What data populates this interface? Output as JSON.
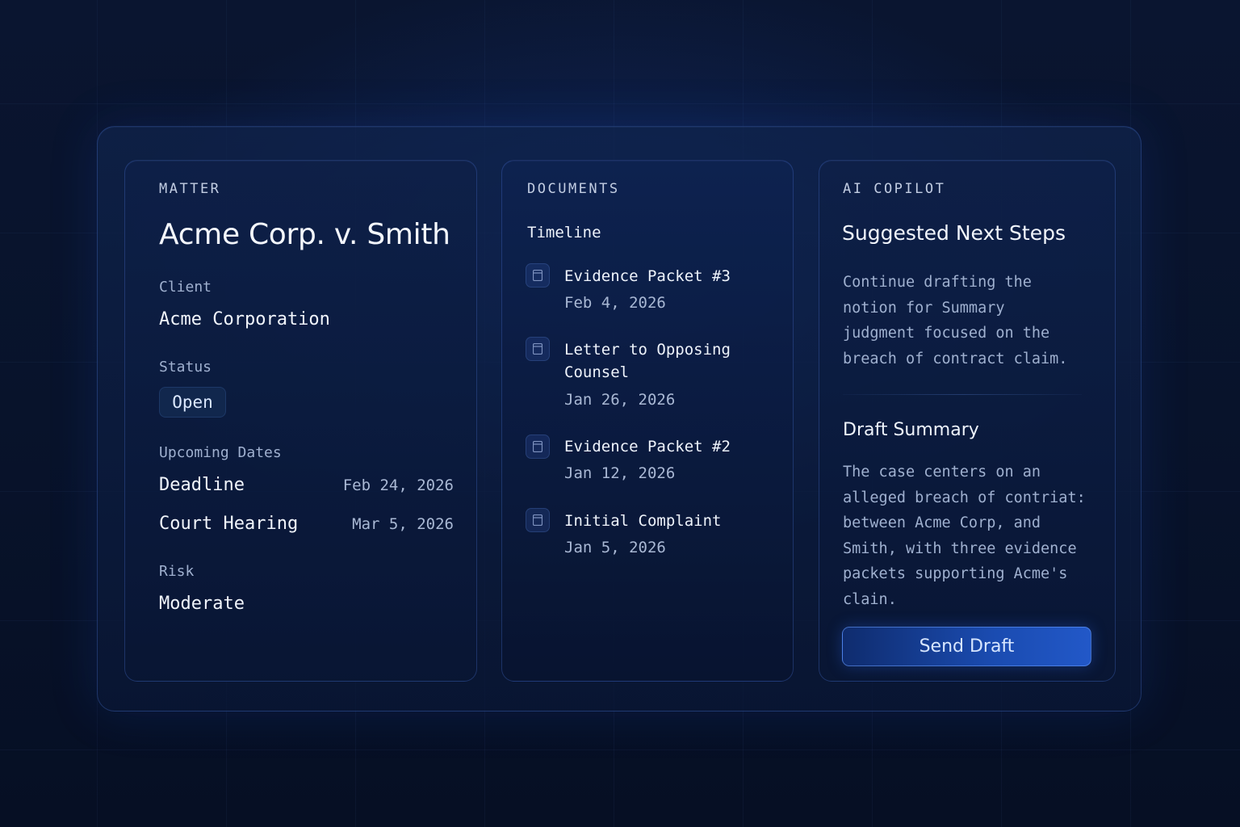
{
  "matter": {
    "eyebrow": "MATTER",
    "title": "Acme Corp. v. Smith",
    "client_label": "Client",
    "client_value": "Acme Corporation",
    "status_label": "Status",
    "status_value": "Open",
    "dates_label": "Upcoming Dates",
    "dates": [
      {
        "label": "Deadline",
        "date": "Feb 24, 2026"
      },
      {
        "label": "Court Hearing",
        "date": "Mar 5, 2026"
      }
    ],
    "risk_label": "Risk",
    "risk_value": "Moderate"
  },
  "documents": {
    "eyebrow": "DOCUMENTS",
    "section": "Timeline",
    "items": [
      {
        "title": "Evidence Packet #3",
        "date": "Feb 4, 2026",
        "icon": "document-icon"
      },
      {
        "title": "Letter to Opposing",
        "title2": "Counsel",
        "date": "Jan 26, 2026",
        "icon": "document-icon"
      },
      {
        "title": "Evidence Packet #2",
        "date": "Jan 12, 2026",
        "icon": "document-icon"
      },
      {
        "title": "Initial Complaint",
        "date": "Jan 5, 2026",
        "icon": "document-icon"
      }
    ]
  },
  "ai": {
    "eyebrow": "AI COPILOT",
    "heading": "Suggested Next Steps",
    "suggestion": "Continue drafting the notion for Summary judgment focused on the breach of contract claim.",
    "draft_heading": "Draft Summary",
    "draft_text": "The case centers on an alleged breach of contriat: between Acme Corp, and Smith, with three evidence packets supporting Acme's clain.",
    "send_label": "Send Draft"
  },
  "colors": {
    "background": "#08132b",
    "accent": "#1a4bb0",
    "panel_border": "#2a4a8c"
  }
}
